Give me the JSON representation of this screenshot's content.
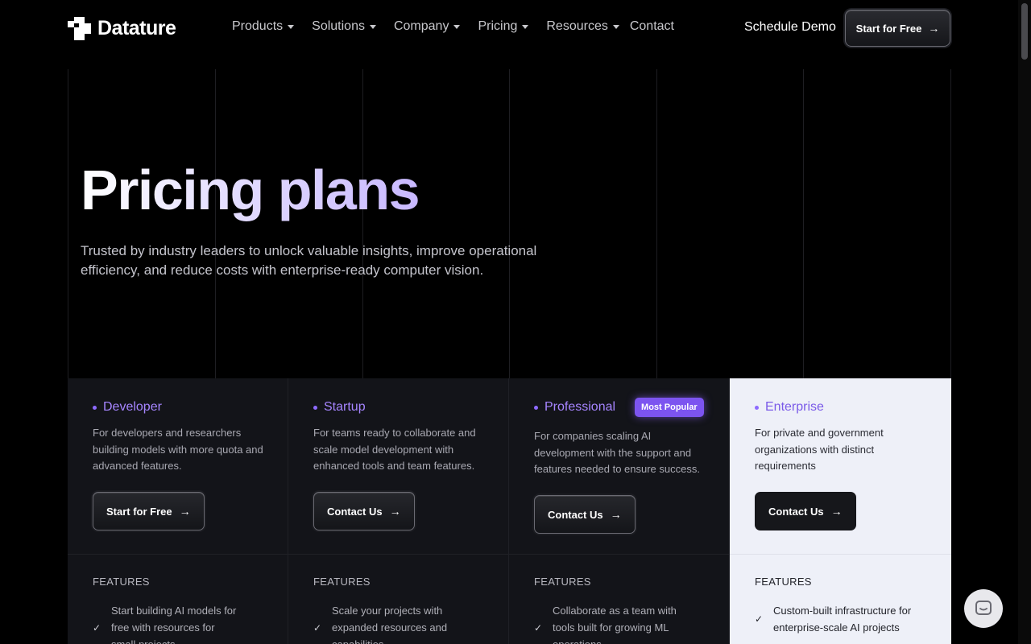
{
  "brand": {
    "name": "Datature"
  },
  "nav": {
    "items": [
      {
        "label": "Products",
        "dropdown": true
      },
      {
        "label": "Solutions",
        "dropdown": true
      },
      {
        "label": "Company",
        "dropdown": true
      },
      {
        "label": "Pricing",
        "dropdown": true
      },
      {
        "label": "Resources",
        "dropdown": true
      },
      {
        "label": "Contact",
        "dropdown": false
      }
    ],
    "schedule_label": "Schedule Demo",
    "start_label": "Start for Free"
  },
  "hero": {
    "title": "Pricing plans",
    "subtitle": "Trusted by industry leaders to unlock valuable insights, improve operational efficiency,  and reduce costs with enterprise-ready computer vision."
  },
  "plans": [
    {
      "name": "Developer",
      "description": "For developers and researchers building models with more quota and advanced features.",
      "button": "Start for Free",
      "features_label": "FEATURES",
      "feature": "Start building AI models for free with resources for small projects"
    },
    {
      "name": "Startup",
      "description": "For teams ready to collaborate and scale model development with enhanced tools and team features.",
      "button": "Contact Us",
      "features_label": "FEATURES",
      "feature": "Scale your projects with expanded resources and capabilities"
    },
    {
      "name": "Professional",
      "badge": "Most Popular",
      "description": "For companies scaling AI development with the support and features needed to ensure success.",
      "button": "Contact Us",
      "features_label": "FEATURES",
      "feature": "Collaborate as a team with tools built for growing ML operations"
    },
    {
      "name": "Enterprise",
      "description": "For private and government organizations with distinct requirements",
      "button": "Contact Us",
      "features_label": "FEATURES",
      "feature": "Custom-built infrastructure for enterprise-scale AI projects"
    }
  ],
  "colors": {
    "background": "#000000",
    "accent": "#7c54f0",
    "plan_name": "#a685ff",
    "enterprise_bg": "#eef0f8"
  },
  "icons": {
    "arrow": "arrow-right-icon",
    "check": "check-icon",
    "chat": "chat-icon"
  }
}
